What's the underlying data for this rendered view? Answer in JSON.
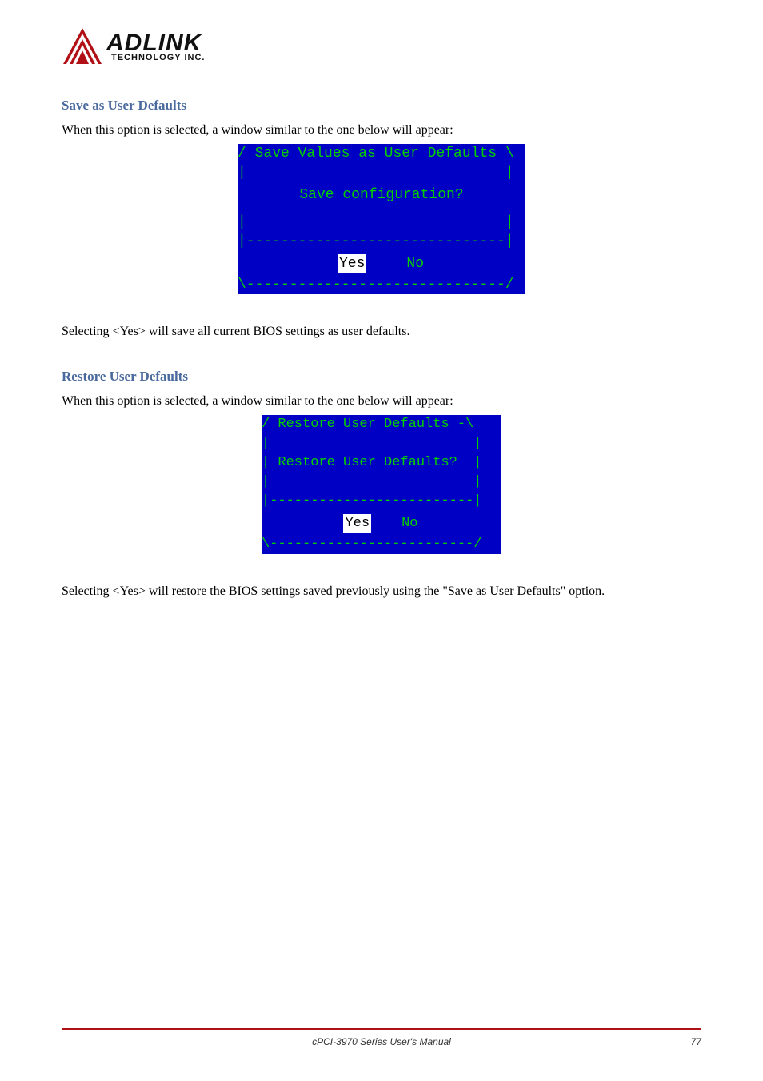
{
  "logo": {
    "main": "ADLINK",
    "sub": "TECHNOLOGY INC."
  },
  "section1": {
    "heading": "Save as User Defaults",
    "intro": "When this option is selected, a window similar to the one below will appear:",
    "dialog": {
      "title": "Save Values as User Defaults",
      "message": "Save configuration?",
      "yes": "Yes",
      "no": "No"
    },
    "after": "Selecting <Yes> will save all current BIOS settings as user defaults."
  },
  "section2": {
    "heading": "Restore User Defaults",
    "intro": "When this option is selected, a window similar to the one below will appear:",
    "dialog": {
      "title": "Restore User Defaults",
      "message": "Restore User Defaults?",
      "yes": "Yes",
      "no": "No"
    },
    "after": "Selecting <Yes> will restore the BIOS settings saved previously using the \"Save as User Defaults\" option."
  },
  "footer": {
    "text": "cPCI-3970 Series User's Manual",
    "page": "77"
  }
}
